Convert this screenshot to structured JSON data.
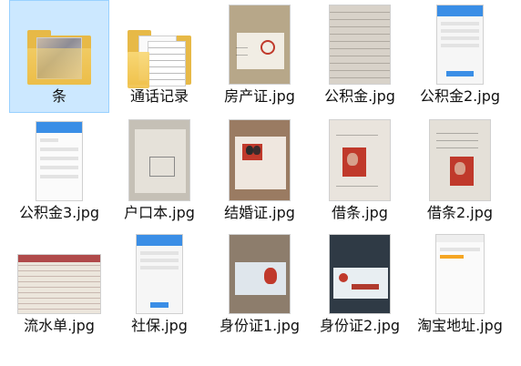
{
  "files": [
    {
      "id": "tiao",
      "label": "条",
      "kind": "folder",
      "selected": true
    },
    {
      "id": "tonghua",
      "label": "通话记录",
      "kind": "folder"
    },
    {
      "id": "fangchan",
      "label": "房产证.jpg",
      "kind": "photo",
      "theme": "cert-open"
    },
    {
      "id": "gjj",
      "label": "公积金.jpg",
      "kind": "photo",
      "theme": "paper-table"
    },
    {
      "id": "gjj2",
      "label": "公积金2.jpg",
      "kind": "photo",
      "theme": "phone"
    },
    {
      "id": "gjj3",
      "label": "公积金3.jpg",
      "kind": "photo",
      "theme": "phone-data"
    },
    {
      "id": "hukou",
      "label": "户口本.jpg",
      "kind": "photo",
      "theme": "hukou"
    },
    {
      "id": "jiehun",
      "label": "结婚证.jpg",
      "kind": "photo",
      "theme": "marriage"
    },
    {
      "id": "jietiao",
      "label": "借条.jpg",
      "kind": "photo",
      "theme": "iou"
    },
    {
      "id": "jietiao2",
      "label": "借条2.jpg",
      "kind": "photo",
      "theme": "iou2"
    },
    {
      "id": "liushui",
      "label": "流水单.jpg",
      "kind": "photo",
      "theme": "statement"
    },
    {
      "id": "shebao",
      "label": "社保.jpg",
      "kind": "photo",
      "theme": "phone"
    },
    {
      "id": "sfz1",
      "label": "身份证1.jpg",
      "kind": "photo",
      "theme": "idcard"
    },
    {
      "id": "sfz2",
      "label": "身份证2.jpg",
      "kind": "photo",
      "theme": "idcard-back"
    },
    {
      "id": "taobao",
      "label": "淘宝地址.jpg",
      "kind": "photo",
      "theme": "phone-white"
    }
  ],
  "colors": {
    "selection": "#cce8ff",
    "folder": "#e7b947",
    "phone_header": "#3a8ee6"
  }
}
